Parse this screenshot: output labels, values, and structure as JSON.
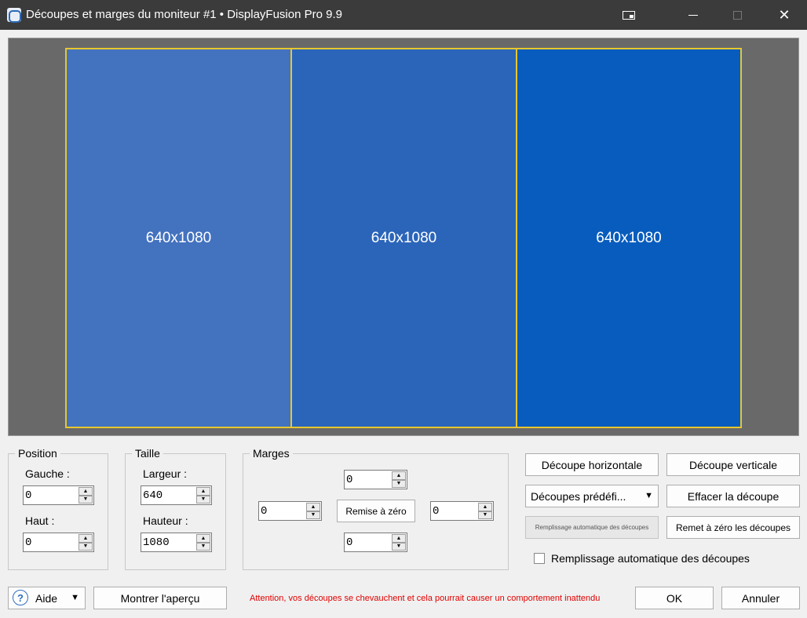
{
  "window": {
    "title": "Découpes et marges du moniteur #1 • DisplayFusion Pro 9.9",
    "close_glyph": "✕"
  },
  "preview": {
    "splits": [
      {
        "label": "640x1080",
        "color": "#4372bf"
      },
      {
        "label": "640x1080",
        "color": "#2b65ba"
      },
      {
        "label": "640x1080",
        "color": "#085cbd"
      }
    ]
  },
  "position": {
    "legend": "Position",
    "left_label": "Gauche :",
    "left_value": "0",
    "top_label": "Haut :",
    "top_value": "0"
  },
  "size": {
    "legend": "Taille",
    "width_label": "Largeur :",
    "width_value": "640",
    "height_label": "Hauteur :",
    "height_value": "1080"
  },
  "margins": {
    "legend": "Marges",
    "top_value": "0",
    "left_value": "0",
    "right_value": "0",
    "bottom_value": "0",
    "reset_label": "Remise à zéro"
  },
  "actions": {
    "horizontal_split": "Découpe horizontale",
    "vertical_split": "Découpe verticale",
    "preset_splits": "Découpes prédéfi...",
    "clear_split": "Effacer la découpe",
    "auto_fill": "Remplissage automatique des découpes",
    "reset_splits": "Remet à zéro les découpes",
    "auto_fill_checkbox_label": "Remplissage automatique des découpes",
    "auto_fill_checked": false
  },
  "footer": {
    "help_glyph": "?",
    "help_label": "Aide",
    "preview_button": "Montrer l'aperçu",
    "warning": "Attention, vos découpes se chevauchent et cela pourrait causer un comportement inattendu",
    "ok": "OK",
    "cancel": "Annuler"
  },
  "colors": {
    "split_border": "#e8c72e",
    "preview_bg": "#696969",
    "warning": "#e00000"
  }
}
